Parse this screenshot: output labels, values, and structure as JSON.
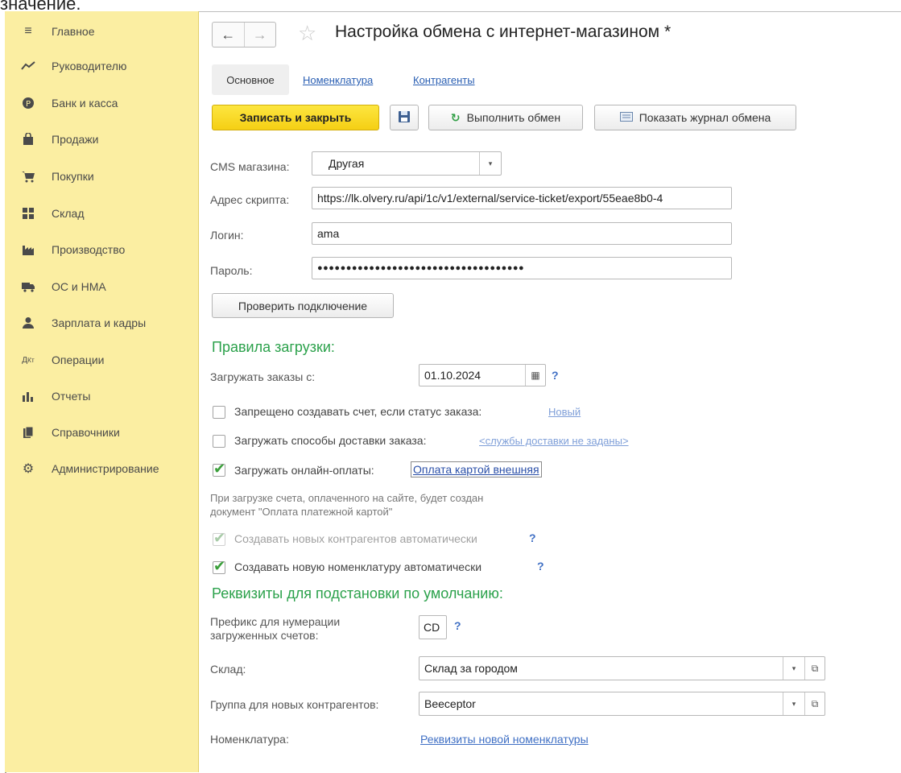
{
  "top_fragment": "значение.",
  "sidebar": {
    "items": [
      {
        "label": "Главное",
        "icon": "menu-icon"
      },
      {
        "label": "Руководителю",
        "icon": "trend-icon"
      },
      {
        "label": "Банк и касса",
        "icon": "coin-icon"
      },
      {
        "label": "Продажи",
        "icon": "bag-icon"
      },
      {
        "label": "Покупки",
        "icon": "cart-icon"
      },
      {
        "label": "Склад",
        "icon": "warehouse-icon"
      },
      {
        "label": "Производство",
        "icon": "factory-icon"
      },
      {
        "label": "ОС и НМА",
        "icon": "truck-icon"
      },
      {
        "label": "Зарплата и кадры",
        "icon": "person-icon"
      },
      {
        "label": "Операции",
        "icon": "operations-icon"
      },
      {
        "label": "Отчеты",
        "icon": "bar-chart-icon"
      },
      {
        "label": "Справочники",
        "icon": "books-icon"
      },
      {
        "label": "Администрирование",
        "icon": "gear-icon"
      }
    ]
  },
  "header": {
    "back": "←",
    "forward": "→",
    "title": "Настройка обмена с интернет-магазином *"
  },
  "tabs": [
    {
      "label": "Основное",
      "active": true
    },
    {
      "label": "Номенклатура",
      "active": false
    },
    {
      "label": "Контрагенты",
      "active": false
    }
  ],
  "toolbar": {
    "save_close": "Записать и закрыть",
    "run_exchange": "Выполнить обмен",
    "show_log": "Показать журнал обмена"
  },
  "connection": {
    "cms_label": "CMS магазина:",
    "cms_value": "Другая",
    "script_label": "Адрес скрипта:",
    "script_value": "https://lk.olvery.ru/api/1c/v1/external/service-ticket/export/55eae8b0-4",
    "login_label": "Логин:",
    "login_value": "ama",
    "password_label": "Пароль:",
    "password_value": "●●●●●●●●●●●●●●●●●●●●●●●●●●●●●●●●●●●●",
    "check_button": "Проверить подключение"
  },
  "load_rules": {
    "heading": "Правила загрузки:",
    "orders_from_label": "Загружать заказы с:",
    "orders_from_value": "01.10.2024",
    "help": "?",
    "forbid_invoice_label": "Запрещено создавать счет, если статус заказа:",
    "forbid_invoice_link": "Новый",
    "delivery_label": "Загружать способы доставки заказа:",
    "delivery_link": "<службы доставки не заданы>",
    "online_pay_label": "Загружать онлайн-оплаты:",
    "online_pay_link": "Оплата картой внешняя",
    "note_line1": "При загрузке счета, оплаченного на сайте, будет создан",
    "note_line2": "документ \"Оплата платежной картой\"",
    "new_contractors_label": "Создавать новых контрагентов автоматически",
    "new_nomenclature_label": "Создавать новую номенклатуру автоматически"
  },
  "defaults": {
    "heading": "Реквизиты для подстановки по умолчанию:",
    "prefix_label_1": "Префикс для нумерации",
    "prefix_label_2": "загруженных счетов:",
    "prefix_value": "CD",
    "warehouse_label": "Склад:",
    "warehouse_value": "Склад за городом",
    "group_label": "Группа для новых контрагентов:",
    "group_value": "Beeceptor",
    "nomenclature_label": "Номенклатура:",
    "nomenclature_link": "Реквизиты новой номенклатуры"
  }
}
